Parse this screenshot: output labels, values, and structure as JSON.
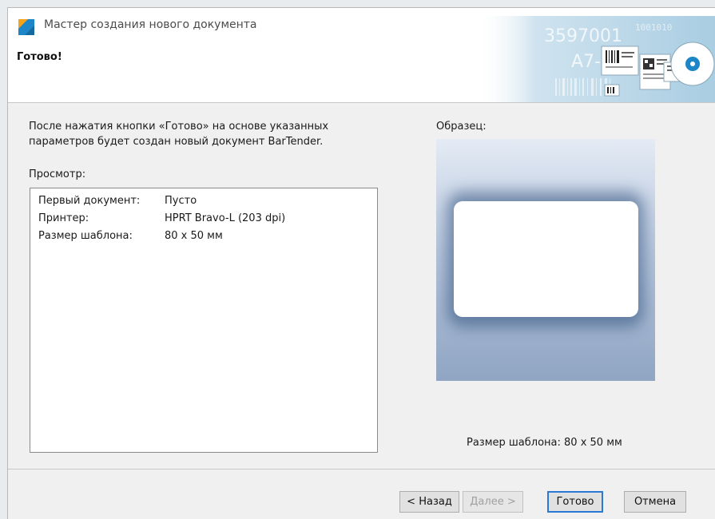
{
  "window": {
    "title": "Мастер создания нового документа"
  },
  "header": {
    "title": "Готово!"
  },
  "banner": {
    "text_1": "3597001",
    "text_2": "A7-118",
    "text_3": "1001010"
  },
  "main": {
    "description": "После нажатия кнопки «Готово» на основе указанных параметров будет создан новый документ BarTender.",
    "preview_label": "Просмотр:",
    "preview_rows": [
      {
        "key": "Первый документ:",
        "value": "Пусто"
      },
      {
        "key": "Принтер:",
        "value": "HPRT Bravo-L (203 dpi)"
      },
      {
        "key": "Размер шаблона:",
        "value": "80 x 50 мм"
      }
    ],
    "sample_label": "Образец:",
    "sample_size": "Размер шаблона:  80 x 50 мм"
  },
  "footer": {
    "back": "< Назад",
    "next": "Далее >",
    "finish": "Готово",
    "cancel": "Отмена"
  },
  "colors": {
    "accent": "#2b79d4",
    "brand_blue": "#1c86c8",
    "brand_orange": "#f6a21a"
  },
  "icons": [
    "app-icon",
    "close-icon"
  ]
}
